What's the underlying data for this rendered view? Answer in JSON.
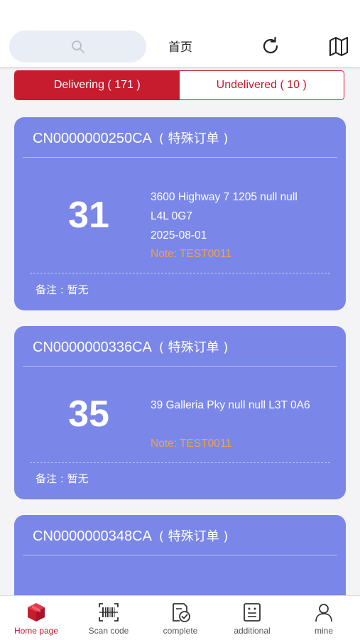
{
  "header": {
    "title": "首页",
    "search_icon": "search-icon",
    "refresh_icon": "refresh-icon",
    "map_icon": "map-icon"
  },
  "tabs": [
    {
      "label": "Delivering ( 171 )",
      "active": true
    },
    {
      "label": "Undelivered ( 10 )",
      "active": false
    }
  ],
  "orders": [
    {
      "id": "CN0000000250CA",
      "tag": "( 特殊订单 )",
      "number": "31",
      "address_line1": "3600 Highway 7 1205 null null",
      "address_line2": "L4L 0G7",
      "date": "2025-08-01",
      "note": "Note: TEST0011",
      "remark": "备注 : 暂无"
    },
    {
      "id": "CN0000000336CA",
      "tag": "( 特殊订单 )",
      "number": "35",
      "address_line1": "39 Galleria Pky null null L3T 0A6",
      "note": "Note: TEST0011",
      "remark": "备注 : 暂无"
    },
    {
      "id": "CN0000000348CA",
      "tag": "( 特殊订单 )"
    }
  ],
  "tabbar": [
    {
      "label": "Home page",
      "icon": "package-icon",
      "active": true
    },
    {
      "label": "Scan code",
      "icon": "barcode-icon",
      "active": false
    },
    {
      "label": "complete",
      "icon": "complete-icon",
      "active": false
    },
    {
      "label": "additional",
      "icon": "additional-icon",
      "active": false
    },
    {
      "label": "mine",
      "icon": "user-icon",
      "active": false
    }
  ],
  "colors": {
    "accent": "#c71b2e",
    "card": "#7a87e8",
    "note": "#f5a04a"
  }
}
